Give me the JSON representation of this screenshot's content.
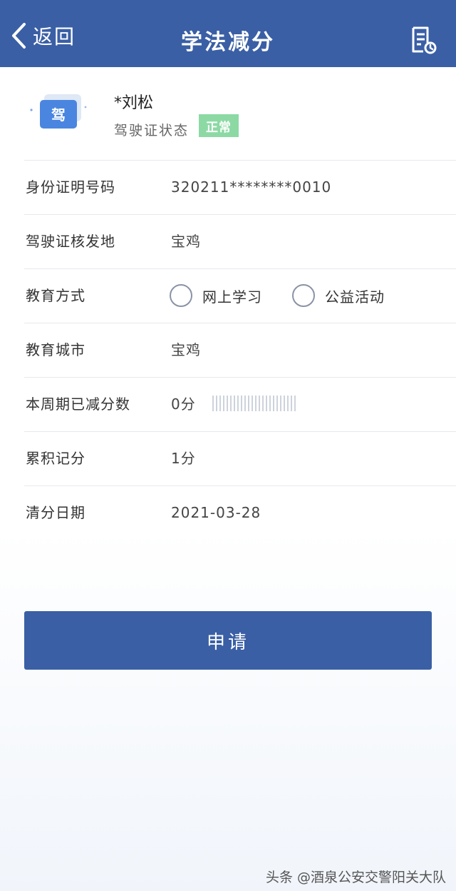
{
  "nav": {
    "back_label": "返回",
    "title": "学法减分"
  },
  "profile": {
    "card_glyph": "驾",
    "name": "*刘松",
    "status_label": "驾驶证状态",
    "status_badge": "正常"
  },
  "fields": {
    "id_number": {
      "label": "身份证明号码",
      "value": "320211********0010"
    },
    "license_origin": {
      "label": "驾驶证核发地",
      "value": "宝鸡"
    },
    "education_method": {
      "label": "教育方式",
      "options": [
        "网上学习",
        "公益活动"
      ]
    },
    "education_city": {
      "label": "教育城市",
      "value": "宝鸡"
    },
    "period_deducted": {
      "label": "本周期已减分数",
      "value": "0分"
    },
    "cumulative_points": {
      "label": "累积记分",
      "value": "1分"
    },
    "clear_date": {
      "label": "清分日期",
      "value": "2021-03-28"
    }
  },
  "actions": {
    "apply_label": "申请"
  },
  "watermark": "头条 @酒泉公安交警阳关大队",
  "colors": {
    "primary": "#3a5fa5",
    "badge": "#8cd9a4",
    "card": "#4a86e0"
  }
}
